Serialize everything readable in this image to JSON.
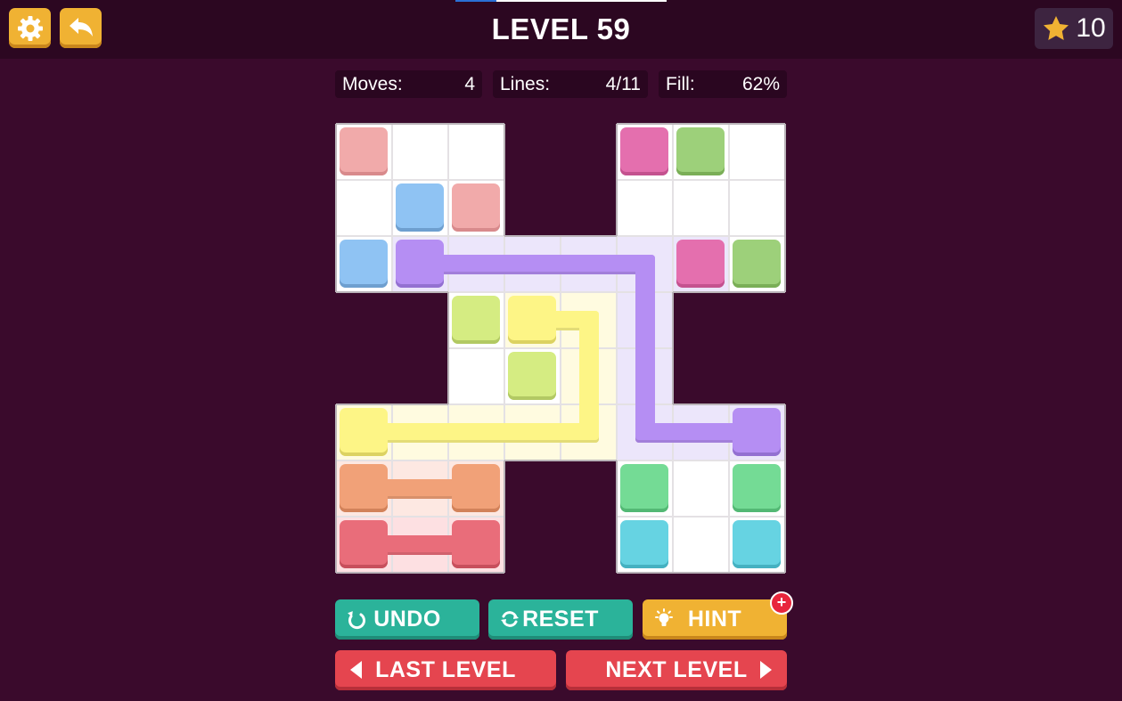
{
  "header": {
    "title": "LEVEL 59",
    "stars": "10",
    "settings_icon": "gear-icon",
    "back_icon": "back-arrow-icon",
    "star_icon": "star-icon"
  },
  "stats": {
    "moves_label": "Moves:",
    "moves_value": "4",
    "lines_label": "Lines:",
    "lines_value": "4/11",
    "fill_label": "Fill:",
    "fill_value": "62%"
  },
  "colors": {
    "background": "#3a0a2c",
    "topbar": "#2c0721",
    "accent_yellow": "#f0b233",
    "teal": "#2bb39a",
    "red": "#e5454f"
  },
  "buttons": {
    "undo": "UNDO",
    "reset": "RESET",
    "hint": "HINT",
    "hint_badge": "+",
    "last_level": "LAST LEVEL",
    "next_level": "NEXT LEVEL"
  },
  "board": {
    "cols": 8,
    "rows": 8,
    "cells": [
      [
        0,
        0
      ],
      [
        0,
        1
      ],
      [
        0,
        2
      ],
      [
        0,
        5
      ],
      [
        0,
        6
      ],
      [
        0,
        7
      ],
      [
        1,
        0
      ],
      [
        1,
        1
      ],
      [
        1,
        2
      ],
      [
        1,
        5
      ],
      [
        1,
        6
      ],
      [
        1,
        7
      ],
      [
        2,
        0
      ],
      [
        2,
        1
      ],
      [
        2,
        2
      ],
      [
        2,
        3
      ],
      [
        2,
        4
      ],
      [
        2,
        5
      ],
      [
        2,
        6
      ],
      [
        2,
        7
      ],
      [
        3,
        2
      ],
      [
        3,
        3
      ],
      [
        3,
        4
      ],
      [
        3,
        5
      ],
      [
        4,
        2
      ],
      [
        4,
        3
      ],
      [
        4,
        4
      ],
      [
        4,
        5
      ],
      [
        5,
        0
      ],
      [
        5,
        1
      ],
      [
        5,
        2
      ],
      [
        5,
        3
      ],
      [
        5,
        4
      ],
      [
        5,
        5
      ],
      [
        5,
        6
      ],
      [
        5,
        7
      ],
      [
        6,
        0
      ],
      [
        6,
        1
      ],
      [
        6,
        2
      ],
      [
        6,
        5
      ],
      [
        6,
        6
      ],
      [
        6,
        7
      ],
      [
        7,
        0
      ],
      [
        7,
        1
      ],
      [
        7,
        2
      ],
      [
        7,
        5
      ],
      [
        7,
        6
      ],
      [
        7,
        7
      ]
    ],
    "tints": [
      {
        "color": "#ece6fb",
        "cells": [
          [
            2,
            1
          ],
          [
            2,
            2
          ],
          [
            2,
            3
          ],
          [
            2,
            4
          ],
          [
            2,
            5
          ],
          [
            2,
            6
          ],
          [
            3,
            5
          ],
          [
            4,
            5
          ],
          [
            5,
            5
          ],
          [
            5,
            6
          ],
          [
            5,
            7
          ]
        ]
      },
      {
        "color": "#fffbe0",
        "cells": [
          [
            3,
            3
          ],
          [
            3,
            4
          ],
          [
            4,
            4
          ],
          [
            5,
            0
          ],
          [
            5,
            1
          ],
          [
            5,
            2
          ],
          [
            5,
            3
          ],
          [
            5,
            4
          ]
        ]
      },
      {
        "color": "#fde8e2",
        "cells": [
          [
            6,
            0
          ],
          [
            6,
            1
          ],
          [
            6,
            2
          ]
        ]
      },
      {
        "color": "#fde0e2",
        "cells": [
          [
            7,
            0
          ],
          [
            7,
            1
          ],
          [
            7,
            2
          ]
        ]
      }
    ],
    "dots": [
      {
        "r": 0,
        "c": 0,
        "color": "#f1aaaa",
        "shadow": "#d88a8c"
      },
      {
        "r": 0,
        "c": 5,
        "color": "#e46fae",
        "shadow": "#c4528f"
      },
      {
        "r": 0,
        "c": 6,
        "color": "#9dd07a",
        "shadow": "#7aae57"
      },
      {
        "r": 1,
        "c": 1,
        "color": "#8fc3f3",
        "shadow": "#6e9fcf"
      },
      {
        "r": 1,
        "c": 2,
        "color": "#f1aaaa",
        "shadow": "#d88a8c"
      },
      {
        "r": 2,
        "c": 0,
        "color": "#8fc3f3",
        "shadow": "#6e9fcf"
      },
      {
        "r": 2,
        "c": 1,
        "color": "#b58ef3",
        "shadow": "#9370d1"
      },
      {
        "r": 2,
        "c": 6,
        "color": "#e46fae",
        "shadow": "#c4528f"
      },
      {
        "r": 2,
        "c": 7,
        "color": "#9dd07a",
        "shadow": "#7aae57"
      },
      {
        "r": 3,
        "c": 2,
        "color": "#d5ec82",
        "shadow": "#b2c963"
      },
      {
        "r": 3,
        "c": 3,
        "color": "#fdf586",
        "shadow": "#dcd262"
      },
      {
        "r": 4,
        "c": 3,
        "color": "#d5ec82",
        "shadow": "#b2c963"
      },
      {
        "r": 5,
        "c": 0,
        "color": "#fdf586",
        "shadow": "#dcd262"
      },
      {
        "r": 5,
        "c": 7,
        "color": "#b58ef3",
        "shadow": "#9370d1"
      },
      {
        "r": 6,
        "c": 0,
        "color": "#f1a178",
        "shadow": "#d2825a"
      },
      {
        "r": 6,
        "c": 2,
        "color": "#f1a178",
        "shadow": "#d2825a"
      },
      {
        "r": 6,
        "c": 5,
        "color": "#74db95",
        "shadow": "#53b874"
      },
      {
        "r": 6,
        "c": 7,
        "color": "#74db95",
        "shadow": "#53b874"
      },
      {
        "r": 7,
        "c": 0,
        "color": "#e96d7a",
        "shadow": "#c74f5c"
      },
      {
        "r": 7,
        "c": 2,
        "color": "#e96d7a",
        "shadow": "#c74f5c"
      },
      {
        "r": 7,
        "c": 5,
        "color": "#66d3e2",
        "shadow": "#45b1c1"
      },
      {
        "r": 7,
        "c": 7,
        "color": "#66d3e2",
        "shadow": "#45b1c1"
      }
    ],
    "paths": [
      {
        "color": "#b58ef3",
        "cells": [
          [
            2,
            1
          ],
          [
            2,
            5
          ],
          [
            5,
            5
          ],
          [
            5,
            7
          ]
        ]
      },
      {
        "color": "#fdf586",
        "cells": [
          [
            3,
            3
          ],
          [
            3,
            4
          ],
          [
            5,
            4
          ],
          [
            5,
            0
          ]
        ]
      },
      {
        "color": "#f1a178",
        "cells": [
          [
            6,
            0
          ],
          [
            6,
            2
          ]
        ]
      },
      {
        "color": "#e96d7a",
        "cells": [
          [
            7,
            0
          ],
          [
            7,
            2
          ]
        ]
      }
    ]
  }
}
